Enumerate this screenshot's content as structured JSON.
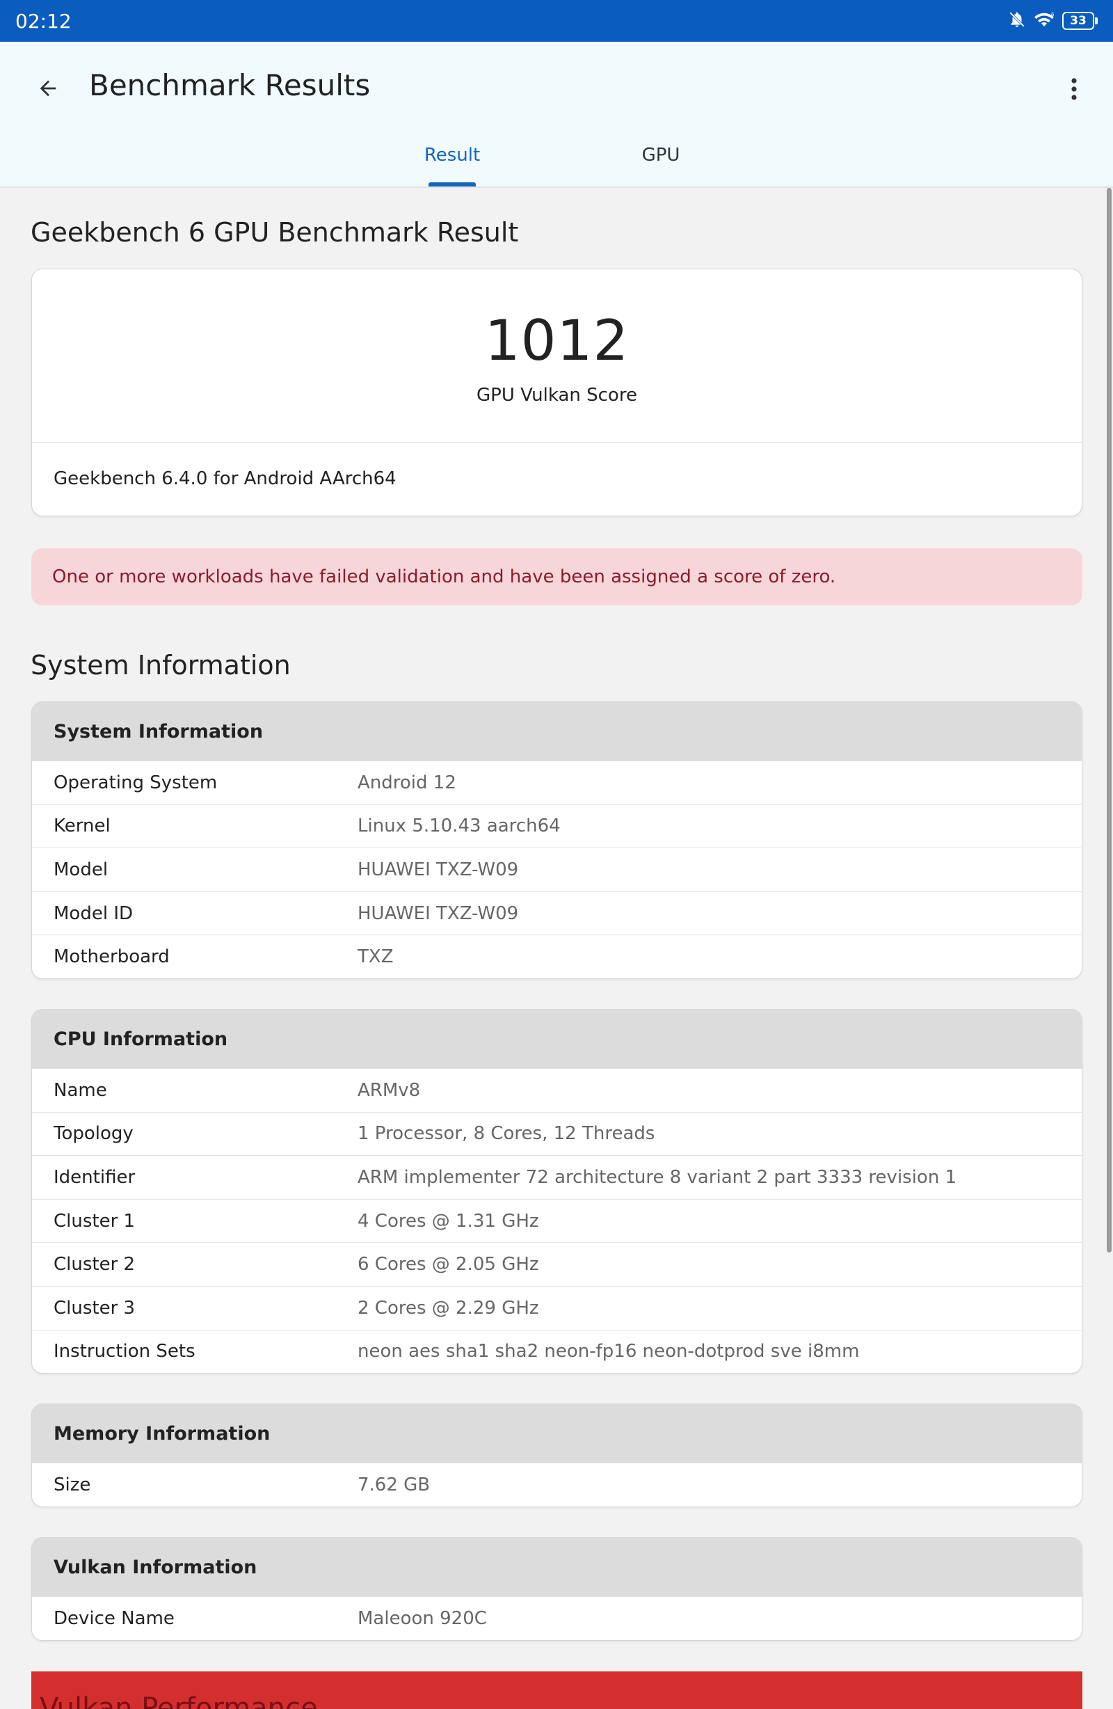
{
  "status_bar": {
    "time": "02:12",
    "battery_level": "33"
  },
  "app_bar": {
    "title": "Benchmark Results"
  },
  "tabs": [
    {
      "label": "Result"
    },
    {
      "label": "GPU"
    }
  ],
  "page_title": "Geekbench 6 GPU Benchmark Result",
  "score": {
    "value": "1012",
    "label": "GPU Vulkan Score",
    "version": "Geekbench 6.4.0 for Android AArch64"
  },
  "warning": "One or more workloads have failed validation and have been assigned a score of zero.",
  "section_title": "System Information",
  "system_info": {
    "title": "System Information",
    "rows": [
      {
        "key": "Operating System",
        "value": "Android 12"
      },
      {
        "key": "Kernel",
        "value": "Linux 5.10.43 aarch64"
      },
      {
        "key": "Model",
        "value": "HUAWEI TXZ-W09"
      },
      {
        "key": "Model ID",
        "value": "HUAWEI TXZ-W09"
      },
      {
        "key": "Motherboard",
        "value": "TXZ"
      }
    ]
  },
  "cpu_info": {
    "title": "CPU Information",
    "rows": [
      {
        "key": "Name",
        "value": "ARMv8"
      },
      {
        "key": "Topology",
        "value": "1 Processor, 8 Cores, 12 Threads"
      },
      {
        "key": "Identifier",
        "value": "ARM implementer 72 architecture 8 variant 2 part 3333 revision 1"
      },
      {
        "key": "Cluster 1",
        "value": "4 Cores @ 1.31 GHz"
      },
      {
        "key": "Cluster 2",
        "value": "6 Cores @ 2.05 GHz"
      },
      {
        "key": "Cluster 3",
        "value": "2 Cores @ 2.29 GHz"
      },
      {
        "key": "Instruction Sets",
        "value": "neon aes sha1 sha2 neon-fp16 neon-dotprod sve i8mm"
      }
    ]
  },
  "memory_info": {
    "title": "Memory Information",
    "rows": [
      {
        "key": "Size",
        "value": "7.62 GB"
      }
    ]
  },
  "vulkan_info": {
    "title": "Vulkan Information",
    "rows": [
      {
        "key": "Device Name",
        "value": "Maleoon 920C"
      }
    ]
  },
  "vulkan_performance": {
    "title": "Vulkan Performance"
  },
  "colors": {
    "status_bar": "#0b5cbf",
    "accent": "#1565c0",
    "warning_bg": "#f7d6da",
    "warning_text": "#8a1c28",
    "perf_bar": "#d32f2f"
  },
  "icons": [
    "bell-off-icon",
    "wifi-icon",
    "battery-icon",
    "back-arrow-icon",
    "more-vert-icon"
  ]
}
